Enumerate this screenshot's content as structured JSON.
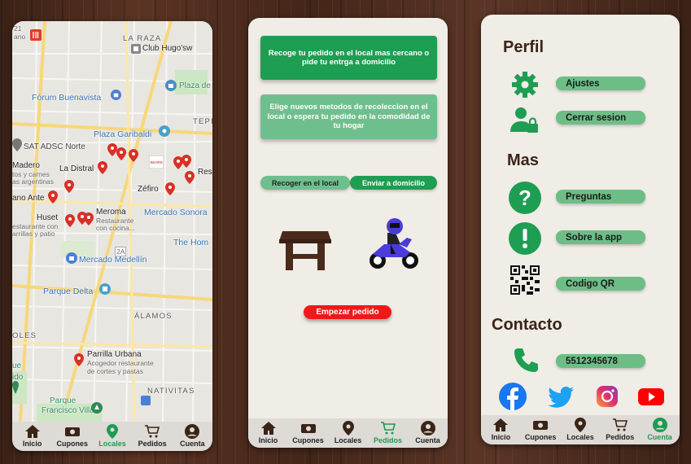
{
  "map_screen": {
    "labels": {
      "raza": "LA RAZA",
      "club": "Club Hugo'sw",
      "plaza_top": "Plaza de",
      "forum": "Fórum Buenavista",
      "tepi": "TEPI",
      "garibaldi": "Plaza Garibaldi",
      "sat": "SAT ADSC Norte",
      "madero": "Madero",
      "madero_sub1": "tos y carnes",
      "madero_sub2": "as argentinas",
      "distral": "La Distral",
      "res": "Res",
      "zefiro": "Zéfiro",
      "ante": "ano Ante",
      "huset": "Huset",
      "huset_sub1": "estaurante con",
      "huset_sub2": "arrillas y patio",
      "meroma": "Meroma",
      "meroma_sub1": "Restaurante",
      "meroma_sub2": "con cocina...",
      "mercado_sonora": "Mercado Sonora",
      "two_a": "2A",
      "the_home": "The Hom",
      "mercado_medellin": "Mercado Medellín",
      "parque_delta": "Parque Delta",
      "alamos": "ÁLAMOS",
      "oles": "OLES",
      "parrilla": "Parrilla Urbana",
      "parrilla_sub1": "Acogedor restaurante",
      "parrilla_sub2": "de cortes y pastas",
      "ue": "ue",
      "ido": "ido",
      "nativitas": "NATIVITAS",
      "parque": "Parque",
      "francisco": "Francisco Villa",
      "top_left_num": "21",
      "top_left_sub": "ano",
      "sears": "SEARS"
    }
  },
  "order_screen": {
    "card1": "Recoge tu pedido en el local mas cercano o pide tu entrga a domicilio",
    "card2": "Elige nuevos metodos de recoleccion en el local o espera tu pedido en la comodidad de tu hogar",
    "pickup_label": "Recoger en el local",
    "delivery_label": "Enviar a domicilio",
    "start_label": "Empezar pedido"
  },
  "account_screen": {
    "profile_title": "Perfil",
    "settings_label": "Ajustes",
    "logout_label": "Cerrar sesion",
    "more_title": "Mas",
    "questions_label": "Preguntas",
    "about_label": "Sobre la app",
    "qr_label": "Codigo QR",
    "contact_title": "Contacto",
    "phone_label": "5512345678"
  },
  "nav": {
    "home": "Inicio",
    "coupons": "Cupones",
    "stores": "Locales",
    "orders": "Pedidos",
    "account": "Cuenta"
  },
  "colors": {
    "primary_green": "#1e9e52",
    "light_green": "#6dbe86",
    "red": "#f01818",
    "brown": "#3a2418"
  }
}
